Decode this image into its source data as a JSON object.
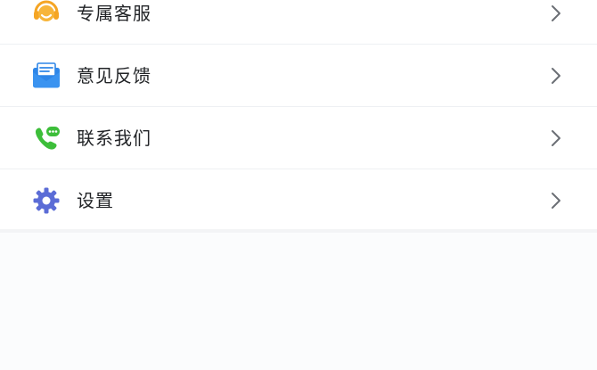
{
  "menu": {
    "items": [
      {
        "label": "专属客服",
        "icon": "headset-icon",
        "color": "#F5A524"
      },
      {
        "label": "意见反馈",
        "icon": "envelope-feedback-icon",
        "color": "#2E86E8"
      },
      {
        "label": "联系我们",
        "icon": "phone-chat-icon",
        "color": "#3DBE3A"
      },
      {
        "label": "设置",
        "icon": "gear-icon",
        "color": "#5B6CD6"
      }
    ],
    "chevron_icon": "chevron-right-icon"
  }
}
